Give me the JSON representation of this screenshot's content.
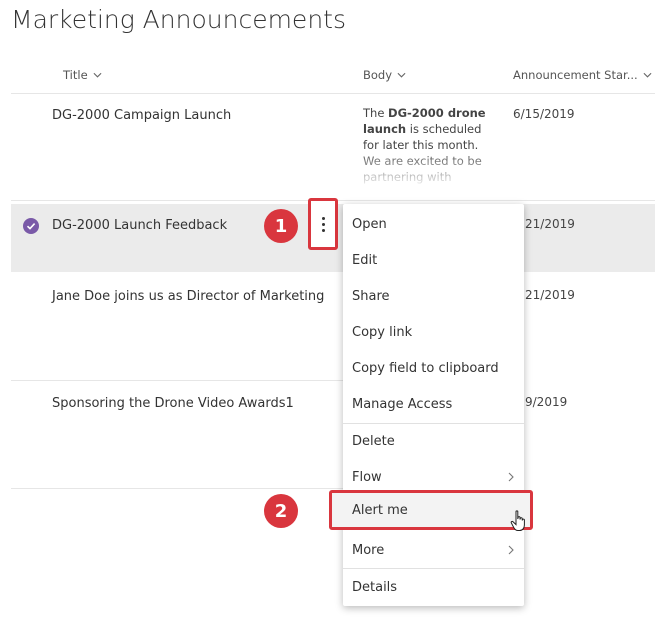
{
  "page": {
    "title": "Marketing Announcements"
  },
  "columns": {
    "title": "Title",
    "body": "Body",
    "announcement_start": "Announcement Star..."
  },
  "rows": [
    {
      "title": "DG-2000 Campaign Launch",
      "date": "6/15/2019",
      "body_prefix": "The ",
      "body_bold": "DG-2000 drone launch",
      "body_rest": " is scheduled for later this month. We are excited to be partnering with LaunchPad to..."
    },
    {
      "title": "DG-2000 Launch Feedback",
      "date": "21/2019",
      "selected": true
    },
    {
      "title": "Jane Doe joins us as Director of Marketing",
      "date": "21/2019"
    },
    {
      "title": "Sponsoring the Drone Video Awards1",
      "date": "9/2019"
    }
  ],
  "context_menu": {
    "items": [
      "Open",
      "Edit",
      "Share",
      "Copy link",
      "Copy field to clipboard",
      "Manage Access",
      "Delete",
      "Flow",
      "Alert me",
      "More",
      "Details"
    ]
  },
  "callouts": {
    "step1": "1",
    "step2": "2"
  },
  "colors": {
    "accent_red": "#d9363e",
    "check_purple": "#7a5aa8",
    "selected_row": "#ebebeb"
  },
  "icons": [
    "chevron-down-icon",
    "more-vertical-icon",
    "check-icon",
    "chevron-right-icon",
    "hand-pointer-icon"
  ]
}
